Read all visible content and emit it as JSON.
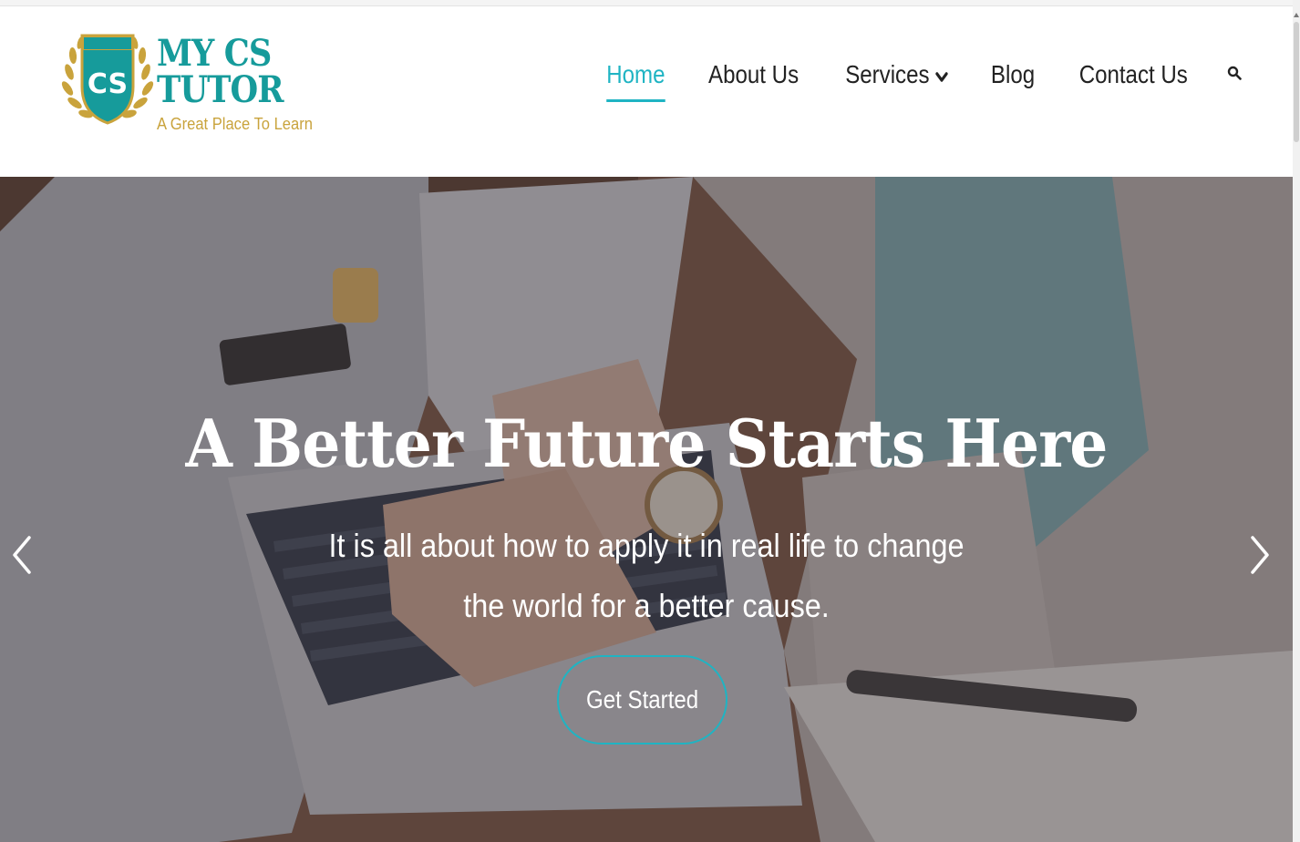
{
  "brand": {
    "title_line1": "MY CS",
    "title_line2": "TUTOR",
    "badge_text": "CS",
    "tagline": "A Great Place To Learn",
    "primary_color": "#169b9b",
    "accent_color": "#c9a33c"
  },
  "nav": {
    "items": [
      {
        "label": "Home",
        "active": true
      },
      {
        "label": "About Us",
        "active": false
      },
      {
        "label": "Services",
        "active": false,
        "has_dropdown": true
      },
      {
        "label": "Blog",
        "active": false
      },
      {
        "label": "Contact Us",
        "active": false
      }
    ],
    "active_color": "#1fb4c3",
    "search_icon": "search-icon",
    "dropdown_icon": "chevron-down-icon"
  },
  "hero": {
    "title": "A Better Future Starts Here",
    "subtitle": "It is all about how to apply it in real life to change the world for a better cause.",
    "cta_label": "Get Started",
    "prev_icon": "chevron-left-icon",
    "next_icon": "chevron-right-icon"
  }
}
